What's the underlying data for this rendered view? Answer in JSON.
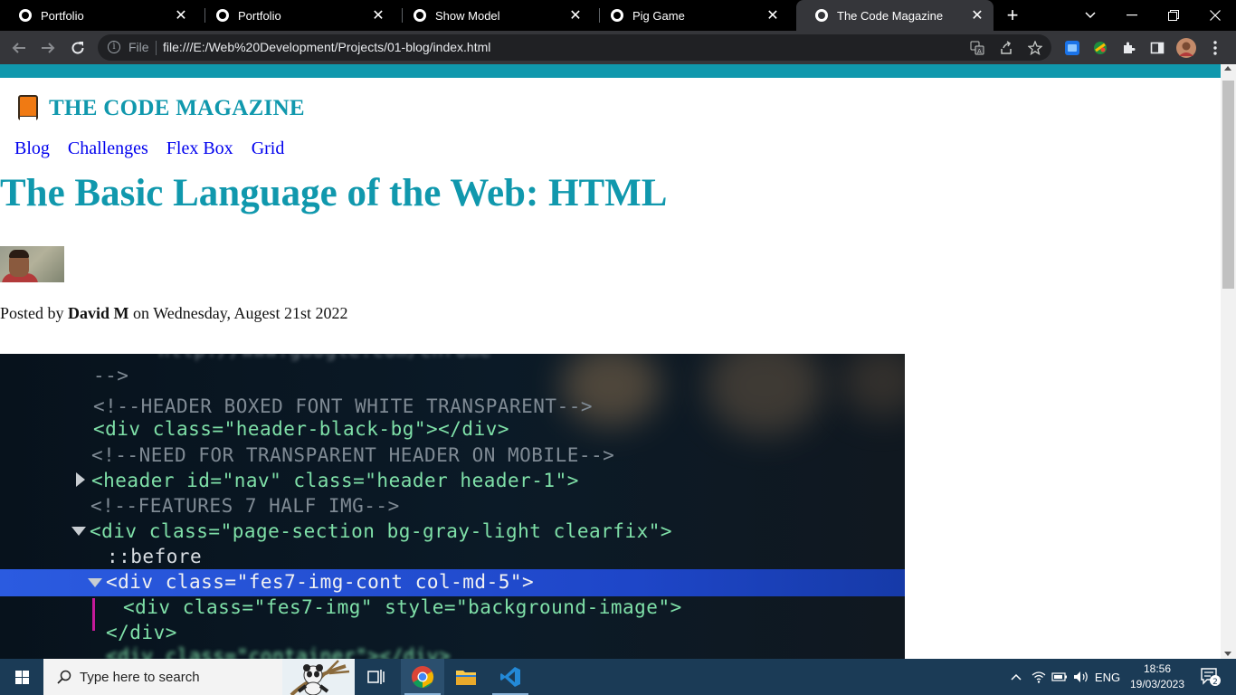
{
  "browser": {
    "tabs": [
      {
        "title": "Portfolio"
      },
      {
        "title": "Portfolio"
      },
      {
        "title": "Show Model"
      },
      {
        "title": "Pig Game"
      },
      {
        "title": "The Code Magazine",
        "active": true
      }
    ],
    "tab_close_glyph": "✕",
    "new_tab_glyph": "+",
    "omnibox": {
      "scheme_label": "File",
      "url": "file:///E:/Web%20Development/Projects/01-blog/index.html"
    }
  },
  "page": {
    "accent_color": "#1098ad",
    "site_title": "THE CODE MAGAZINE",
    "nav": [
      "Blog",
      "Challenges",
      "Flex Box",
      "Grid"
    ],
    "post_title": "The Basic Language of the Web: HTML",
    "meta_prefix": "Posted by",
    "author": "David M",
    "meta_suffix": "on Wednesday, Augest 21st 2022"
  },
  "code_image": {
    "lines": [
      {
        "text": "-->",
        "kind": "com"
      },
      {
        "text": "<!--HEADER BOXED FONT WHITE TRANSPARENT-->",
        "kind": "com"
      },
      {
        "text": "<div class=\"header-black-bg\"></div>",
        "kind": "code"
      },
      {
        "text": "<!--NEED FOR TRANSPARENT HEADER ON MOBILE-->",
        "kind": "com"
      },
      {
        "text": "<header id=\"nav\" class=\"header header-1\">",
        "kind": "code"
      },
      {
        "text": "<!--FEATURES 7 HALF IMG-->",
        "kind": "com"
      },
      {
        "text": "<div class=\"page-section bg-gray-light clearfix\">",
        "kind": "code"
      },
      {
        "text": "::before",
        "kind": "attr"
      },
      {
        "text": "<div class=\"fes7-img-cont col-md-5\">",
        "kind": "code"
      },
      {
        "text": "<div class=\"fes7-img\" style=\"background-image\">",
        "kind": "code"
      },
      {
        "text": "</div>",
        "kind": "code"
      },
      {
        "text": "<div class=\"container\"></div>",
        "kind": "code"
      }
    ],
    "top_fragment": "http://www.google.com/chrome"
  },
  "taskbar": {
    "search_placeholder": "Type here to search",
    "language": "ENG",
    "time": "18:56",
    "date": "19/03/2023",
    "notification_count": "2"
  }
}
